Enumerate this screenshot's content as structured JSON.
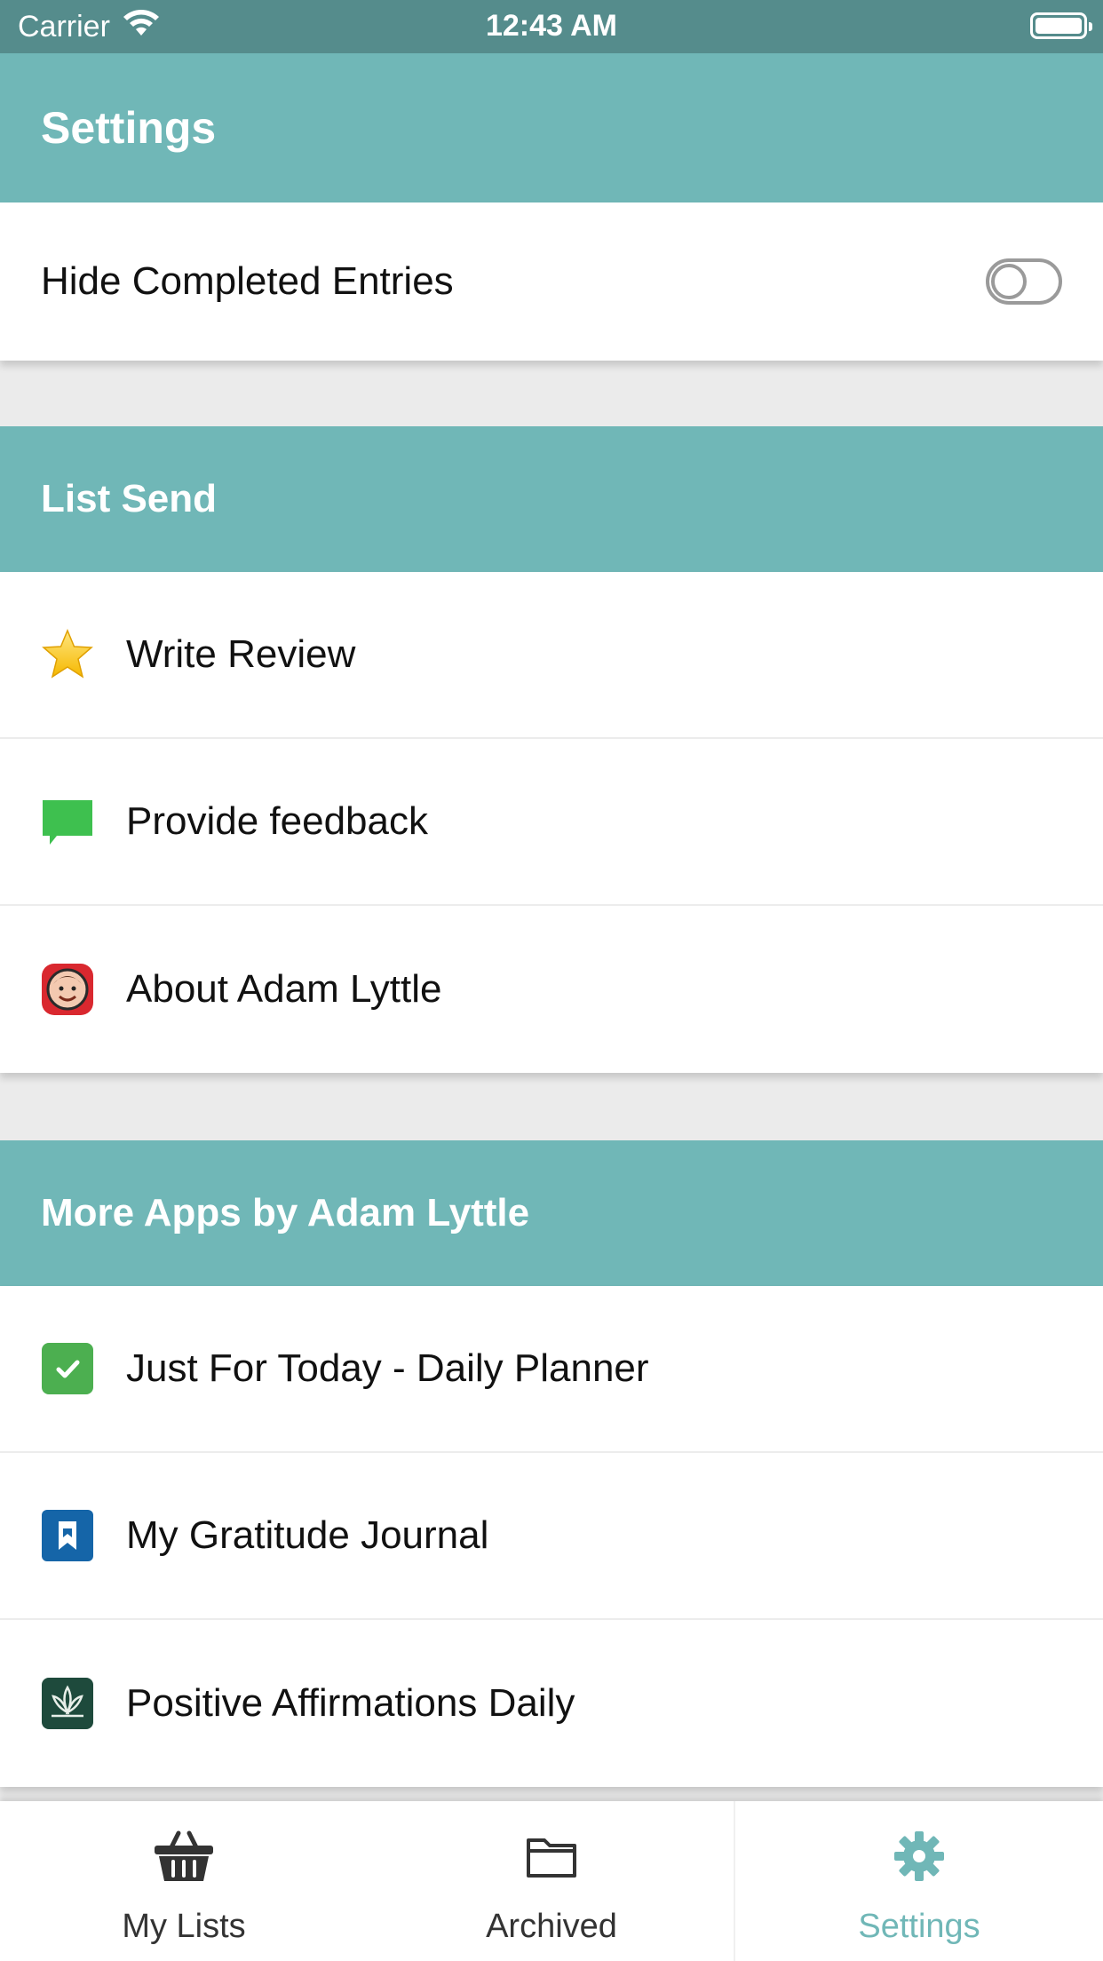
{
  "status_bar": {
    "carrier": "Carrier",
    "time": "12:43 AM"
  },
  "header": {
    "title": "Settings"
  },
  "settings": {
    "hide_completed_label": "Hide Completed Entries",
    "hide_completed_on": false
  },
  "list_send": {
    "header": "List Send",
    "items": [
      {
        "label": "Write Review",
        "icon": "star-icon"
      },
      {
        "label": "Provide feedback",
        "icon": "chat-bubble-icon"
      },
      {
        "label": "About Adam Lyttle",
        "icon": "avatar-icon"
      }
    ]
  },
  "more_apps": {
    "header": "More Apps by Adam Lyttle",
    "items": [
      {
        "label": "Just For Today - Daily Planner",
        "icon": "checkbox-app-icon"
      },
      {
        "label": "My Gratitude Journal",
        "icon": "bookmark-app-icon"
      },
      {
        "label": "Positive Affirmations Daily",
        "icon": "lotus-app-icon"
      }
    ]
  },
  "tabs": [
    {
      "label": "My Lists",
      "icon": "basket-icon",
      "active": false
    },
    {
      "label": "Archived",
      "icon": "folder-icon",
      "active": false
    },
    {
      "label": "Settings",
      "icon": "gear-icon",
      "active": true
    }
  ],
  "colors": {
    "accent": "#70b7b7",
    "status_bar": "#558c8c",
    "tab_active": "#70b7b7"
  }
}
